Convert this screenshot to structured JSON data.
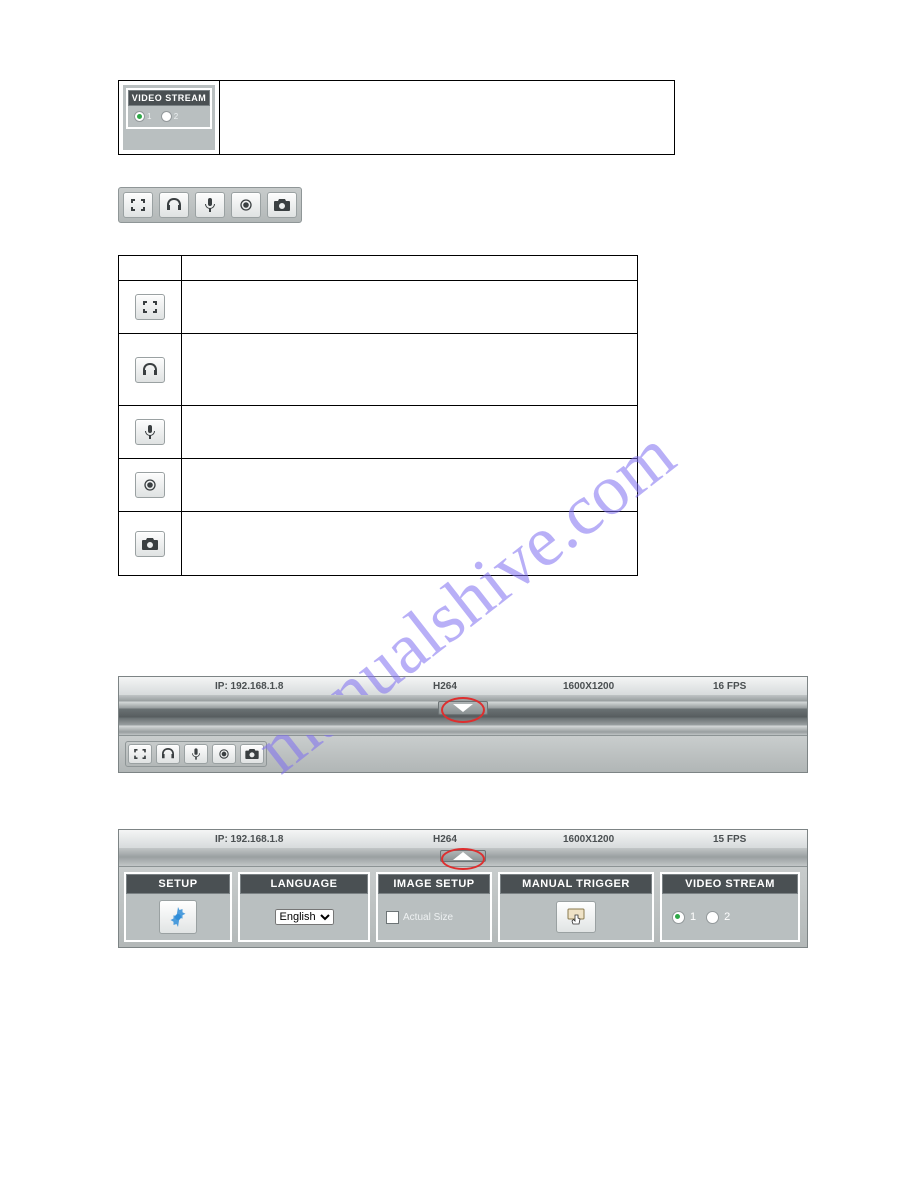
{
  "video_stream_panel": {
    "title": "VIDEO STREAM",
    "opt1": "1",
    "opt2": "2"
  },
  "status_bar_1": {
    "ip": "IP: 192.168.1.8",
    "codec": "H264",
    "res": "1600X1200",
    "fps": "16 FPS"
  },
  "status_bar_2": {
    "ip": "IP: 192.168.1.8",
    "codec": "H264",
    "res": "1600X1200",
    "fps": "15 FPS"
  },
  "panels": {
    "setup": "SETUP",
    "language": "LANGUAGE",
    "language_value": "English",
    "image_setup": "IMAGE SETUP",
    "actual_size": "Actual Size",
    "manual_trigger": "MANUAL TRIGGER",
    "video_stream": "VIDEO STREAM",
    "vs_opt1": "1",
    "vs_opt2": "2"
  }
}
